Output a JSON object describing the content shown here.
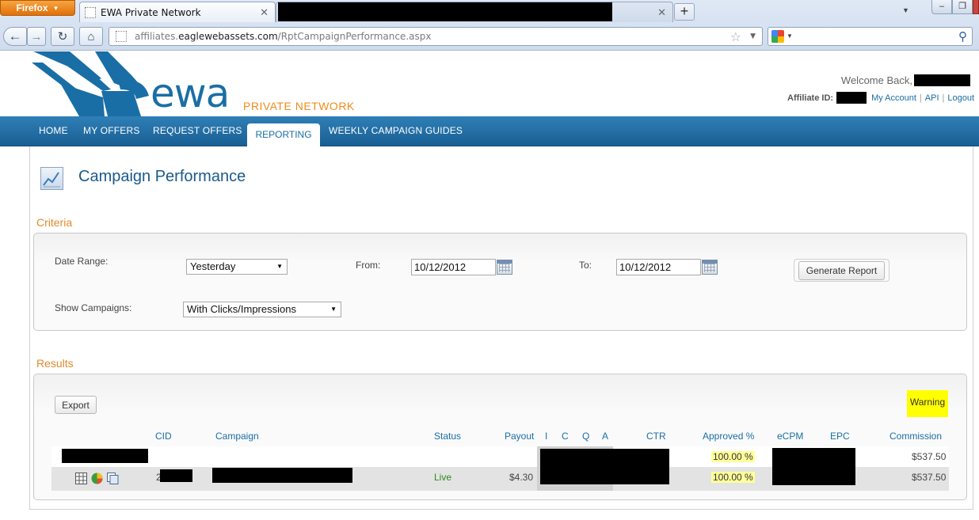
{
  "browser": {
    "app_button": "Firefox",
    "active_tab_title": "EWA Private Network",
    "url_prefix": "affiliates.",
    "url_host": "eaglewebassets.com",
    "url_path": "/RptCampaignPerformance.aspx"
  },
  "header": {
    "logo_text": "ewa",
    "logo_sub": "PRIVATE NETWORK",
    "welcome": "Welcome Back,",
    "affiliate_label": "Affiliate ID:",
    "links": [
      "My Account",
      "API",
      "Logout"
    ],
    "separator": "|"
  },
  "nav": {
    "items": [
      "HOME",
      "MY OFFERS",
      "REQUEST OFFERS",
      "REPORTING",
      "WEEKLY CAMPAIGN GUIDES"
    ]
  },
  "page": {
    "title": "Campaign Performance"
  },
  "criteria": {
    "title": "Criteria",
    "date_range_label": "Date Range:",
    "date_range_value": "Yesterday",
    "from_label": "From:",
    "from_value": "10/12/2012",
    "to_label": "To:",
    "to_value": "10/12/2012",
    "generate_label": "Generate Report",
    "show_campaigns_label": "Show Campaigns:",
    "show_campaigns_value": "With Clicks/Impressions"
  },
  "results": {
    "title": "Results",
    "export_label": "Export",
    "warning_label": "Warning",
    "columns": [
      "CID",
      "Campaign",
      "Status",
      "Payout",
      "I",
      "C",
      "Q",
      "A",
      "CTR",
      "Approved %",
      "eCPM",
      "EPC",
      "Commission"
    ],
    "summary_row": {
      "approved": "100.00 %",
      "commission": "$537.50"
    },
    "rows": [
      {
        "cid_prefix": "2",
        "status": "Live",
        "payout": "$4.30",
        "approved": "100.00 %",
        "commission": "$537.50"
      }
    ]
  },
  "colors": {
    "brand_blue": "#1a6ea6",
    "accent_orange": "#e38a2b",
    "status_live": "#2a8a1a",
    "highlight_yellow": "#ffff99"
  }
}
